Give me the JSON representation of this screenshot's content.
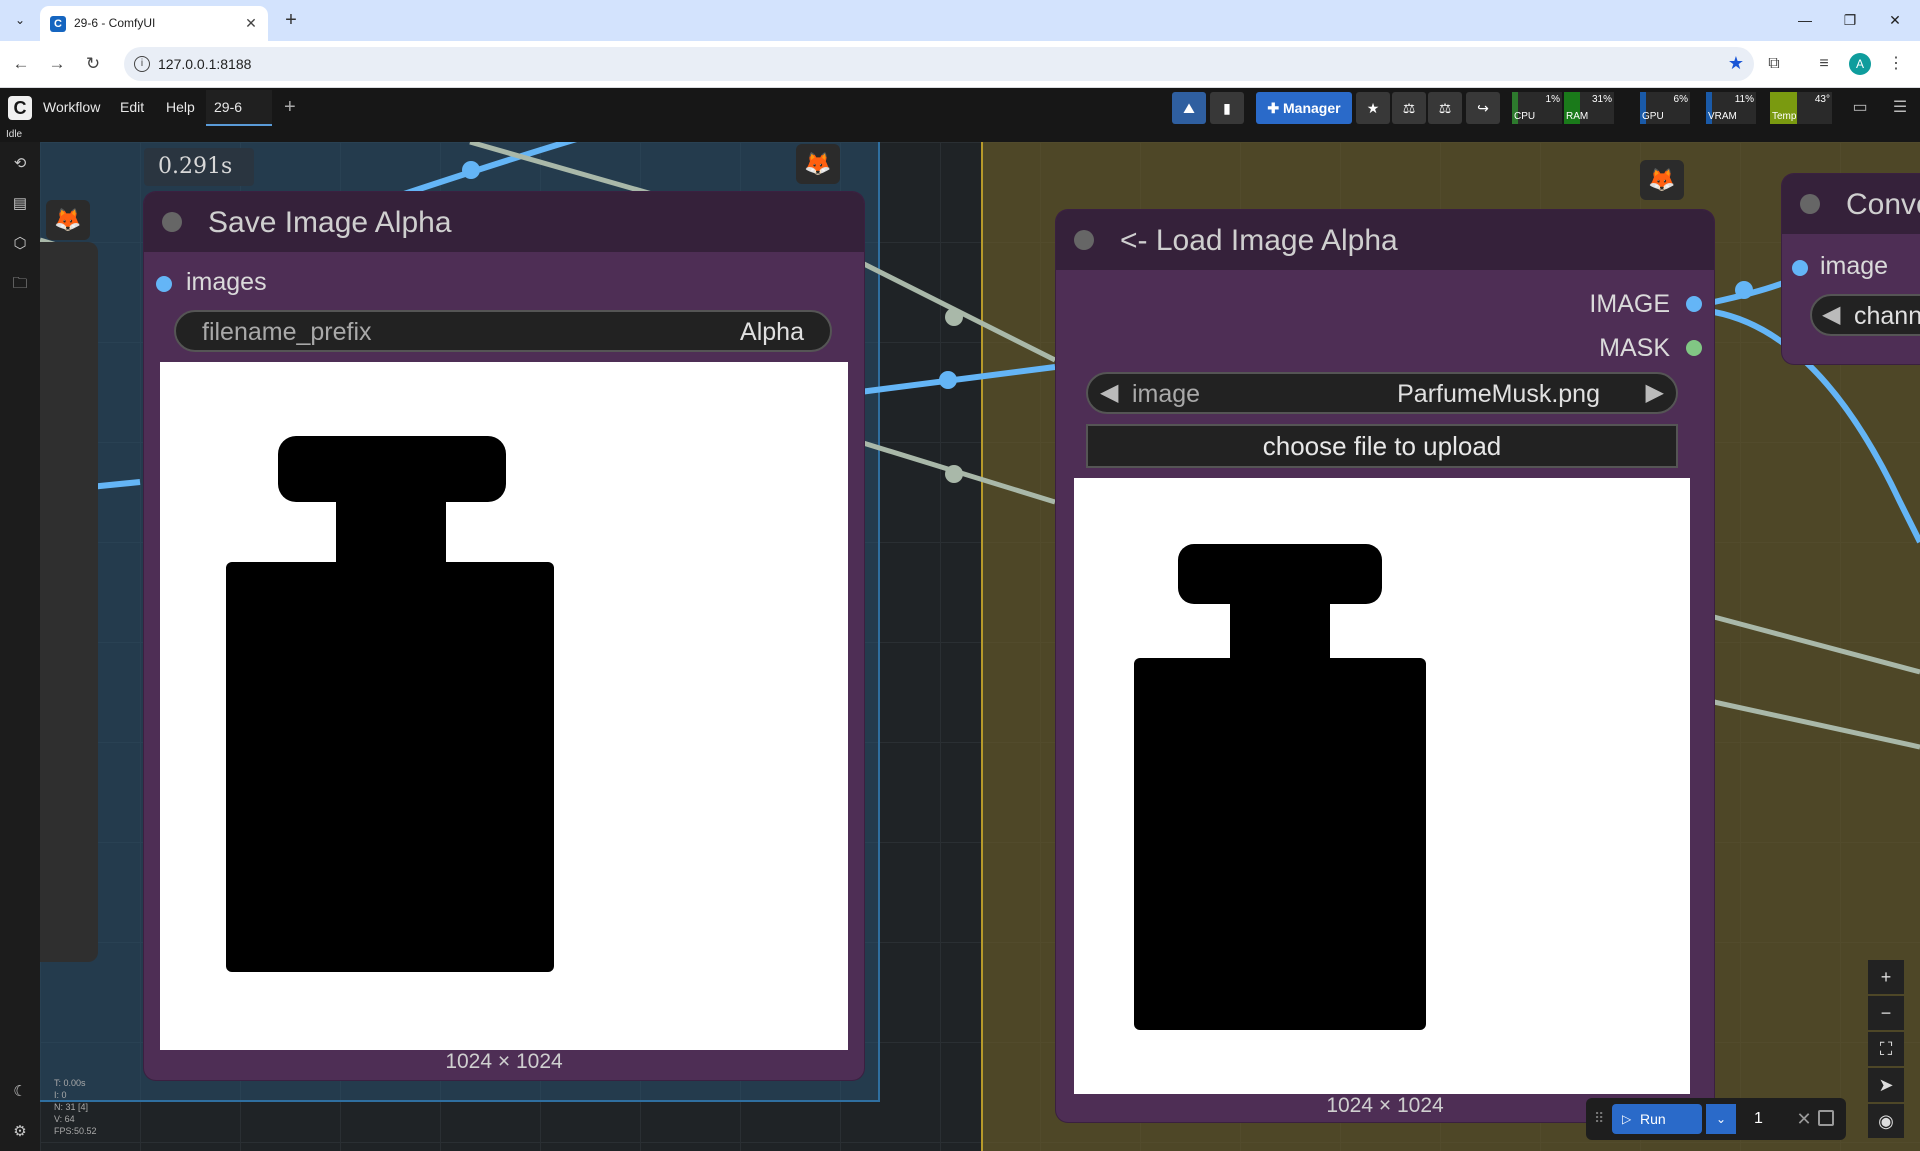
{
  "browser": {
    "tab_title": "29-6 - ComfyUI",
    "url": "127.0.0.1:8188",
    "profile_initial": "A"
  },
  "menu": {
    "items": [
      "Workflow",
      "Edit",
      "Help"
    ],
    "workflow_tab": "29-6",
    "status": "Idle",
    "manager_label": "Manager"
  },
  "metrics": [
    {
      "label": "CPU",
      "value": "1%",
      "color": "#2d7a2d",
      "fill": 0.01
    },
    {
      "label": "RAM",
      "value": "31%",
      "color": "#1a7a1a",
      "fill": 0.31
    },
    {
      "label": "GPU",
      "value": "6%",
      "color": "#1a5aa8",
      "fill": 0.06
    },
    {
      "label": "VRAM",
      "value": "11%",
      "color": "#1a5aa8",
      "fill": 0.11
    },
    {
      "label": "Temp",
      "value": "43°",
      "color": "#7a9a10",
      "fill": 0.43
    }
  ],
  "canvas": {
    "exec_time": "0.291s",
    "info": {
      "t": "T: 0.00s",
      "i": "I: 0",
      "n": "N: 31 [4]",
      "v": "V: 64",
      "fps": "FPS:50.52"
    }
  },
  "save_node": {
    "title": "Save Image Alpha",
    "input_images": "images",
    "widget_name": "filename_prefix",
    "widget_value": "Alpha",
    "dims": "1024 × 1024"
  },
  "load_node": {
    "title": "<- Load Image Alpha",
    "out_image": "IMAGE",
    "out_mask": "MASK",
    "widget_name": "image",
    "widget_value": "ParfumeMusk.png",
    "upload_label": "choose file to upload",
    "dims": "1024 × 1024"
  },
  "conv_node": {
    "title": "Conve",
    "input_image": "image",
    "widget_partial": "chann"
  },
  "run_bar": {
    "run_label": "Run",
    "count": "1"
  },
  "colors": {
    "accent": "#2a6ac9",
    "node_body": "#4e2e55",
    "node_head": "#35213a",
    "wire_image": "#64b5f6",
    "wire_grey": "#a9b8a9"
  }
}
